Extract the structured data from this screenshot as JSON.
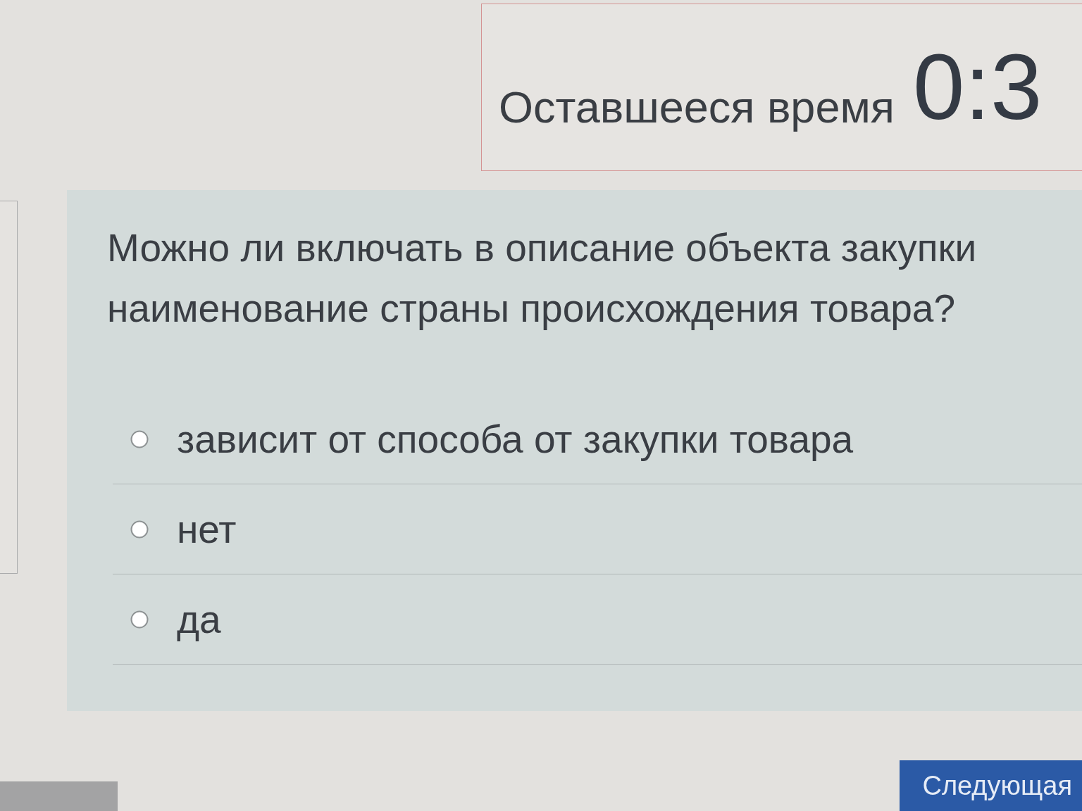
{
  "timer": {
    "label": "Оставшееся время",
    "value": "0:3"
  },
  "question": {
    "text": "Можно ли включать в описание объекта закупки наименование страны происхождения товара?",
    "options": [
      {
        "label": "зависит от способа от закупки товара",
        "selected": false
      },
      {
        "label": "нет",
        "selected": false
      },
      {
        "label": "да",
        "selected": false
      }
    ]
  },
  "navigation": {
    "next_button": "Следующая"
  }
}
